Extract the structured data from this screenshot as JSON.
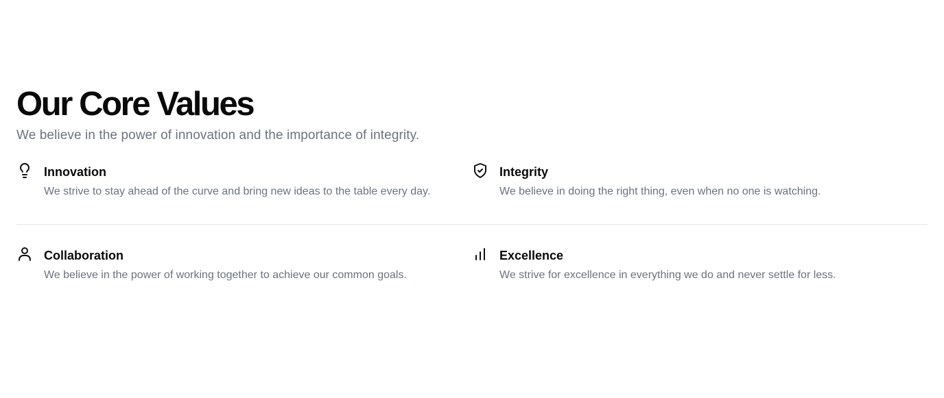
{
  "header": {
    "title": "Our Core Values",
    "subtitle": "We believe in the power of innovation and the importance of integrity."
  },
  "values": [
    {
      "icon": "lightbulb-icon",
      "title": "Innovation",
      "description": "We strive to stay ahead of the curve and bring new ideas to the table every day."
    },
    {
      "icon": "shield-check-icon",
      "title": "Integrity",
      "description": "We believe in doing the right thing, even when no one is watching."
    },
    {
      "icon": "user-icon",
      "title": "Collaboration",
      "description": "We believe in the power of working together to achieve our common goals."
    },
    {
      "icon": "bar-chart-icon",
      "title": "Excellence",
      "description": "We strive for excellence in everything we do and never settle for less."
    }
  ],
  "colors": {
    "title": "#0a0a0a",
    "muted_text": "#6b7280",
    "divider": "#e5e7eb",
    "background": "#ffffff"
  }
}
